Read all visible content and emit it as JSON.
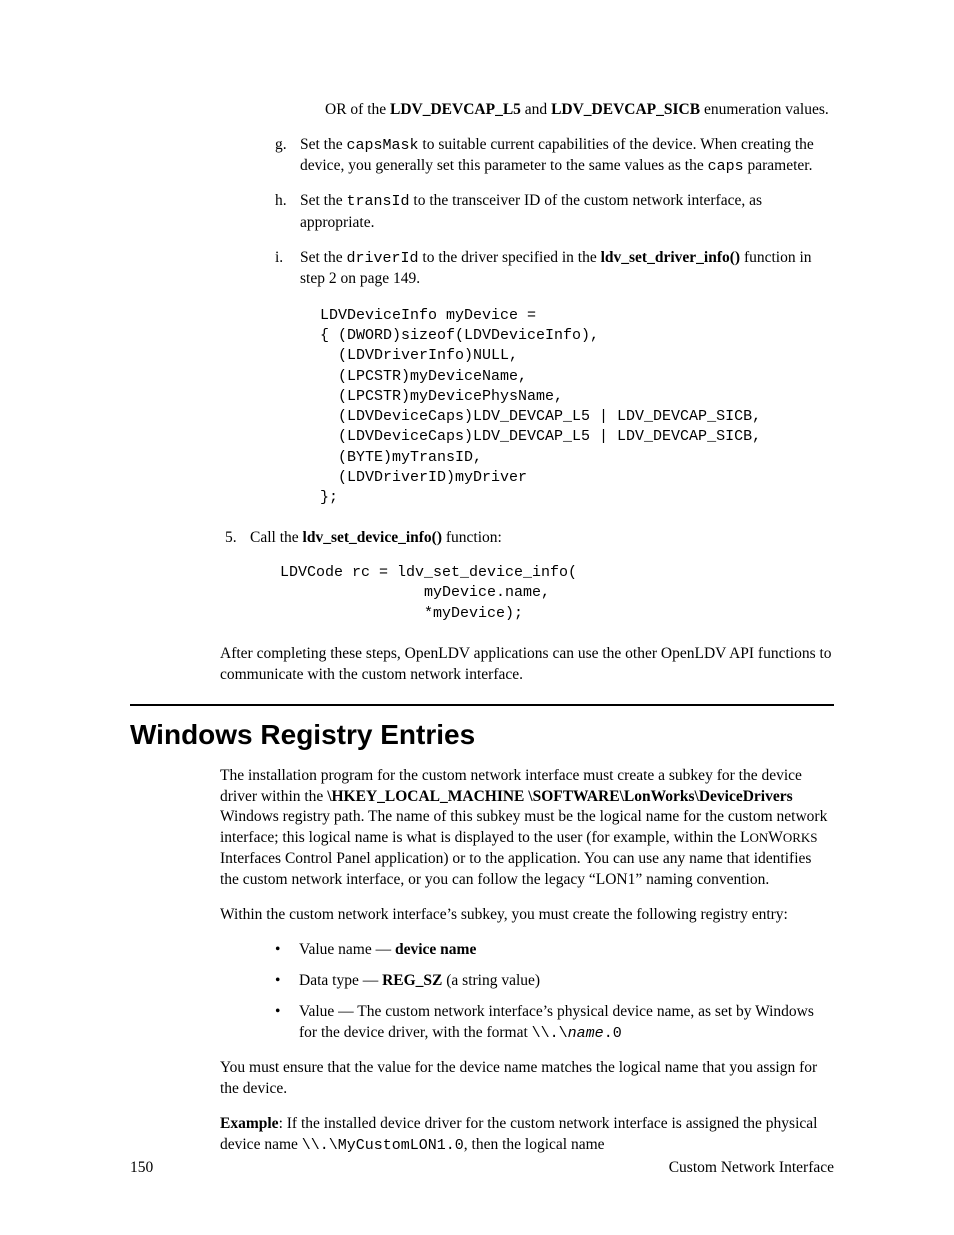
{
  "top_continuation": {
    "prefix": "OR of the ",
    "const1": "LDV_DEVCAP_L5",
    "mid": " and ",
    "const2": "LDV_DEVCAP_SICB",
    "suffix": " enumeration values."
  },
  "item_g": {
    "marker": "g.",
    "t1": "Set the ",
    "code1": "capsMask",
    "t2": " to suitable current capabilities of the device. When creating the device, you generally set this parameter to the same values as the ",
    "code2": "caps",
    "t3": " parameter."
  },
  "item_h": {
    "marker": "h.",
    "t1": "Set the ",
    "code1": "transId",
    "t2": " to the transceiver ID of the custom network interface, as appropriate."
  },
  "item_i": {
    "marker": "i.",
    "t1": "Set the ",
    "code1": "driverId",
    "t2": " to the driver specified in the ",
    "b1": "ldv_set_driver_info()",
    "t3": " function in step 2 on page 149."
  },
  "code_block_1": "LDVDeviceInfo myDevice =\n{ (DWORD)sizeof(LDVDeviceInfo),\n  (LDVDriverInfo)NULL,\n  (LPCSTR)myDeviceName,\n  (LPCSTR)myDevicePhysName,\n  (LDVDeviceCaps)LDV_DEVCAP_L5 | LDV_DEVCAP_SICB,\n  (LDVDeviceCaps)LDV_DEVCAP_L5 | LDV_DEVCAP_SICB,\n  (BYTE)myTransID,\n  (LDVDriverID)myDriver\n};",
  "item_5": {
    "marker": "5.",
    "t1": "Call the ",
    "b1": "ldv_set_device_info()",
    "t2": " function:"
  },
  "code_block_2": "LDVCode rc = ldv_set_device_info(\n                myDevice.name,\n                *myDevice);",
  "after_para": "After completing these steps, OpenLDV applications can use the other OpenLDV API functions to communicate with the custom network interface.",
  "heading": "Windows Registry Entries",
  "reg_para1": {
    "t1": "The installation program for the custom network interface must create a subkey for the device driver within the ",
    "b1": "\\HKEY_LOCAL_MACHINE \\SOFTWARE\\LonWorks\\DeviceDrivers",
    "t2": " Windows registry path.  The name of this subkey must be the logical name for the custom network interface; this logical name is what is displayed to the user (for example, within the L",
    "sc": "ON",
    "t2b": "W",
    "sc2": "ORKS",
    "t3": " Interfaces Control Panel application) or to the application.  You can use any name that identifies the custom network interface, or you can follow the legacy “LON1” naming convention."
  },
  "reg_para2": "Within the custom network interface’s subkey, you must create the following registry entry:",
  "bullets": {
    "b1": {
      "t1": "Value name — ",
      "strong": "device name"
    },
    "b2": {
      "t1": "Data type — ",
      "strong": "REG_SZ",
      "t2": " (a string value)"
    },
    "b3": {
      "t1": "Value —  The custom network interface’s physical device name, as set by Windows for the device driver, with the format  ",
      "code1": "\\\\.\\",
      "ital": "name",
      "code2": ".0"
    }
  },
  "reg_para3": "You must ensure that the value for the device name matches the logical name that you assign for the device.",
  "reg_para4": {
    "strong": "Example",
    "t1": ":  If the installed device driver for the custom network interface is assigned the physical device name ",
    "code": "\\\\.\\MyCustomLON1.0",
    "t2": ", then the logical name"
  },
  "footer": {
    "page": "150",
    "title": "Custom Network Interface"
  }
}
